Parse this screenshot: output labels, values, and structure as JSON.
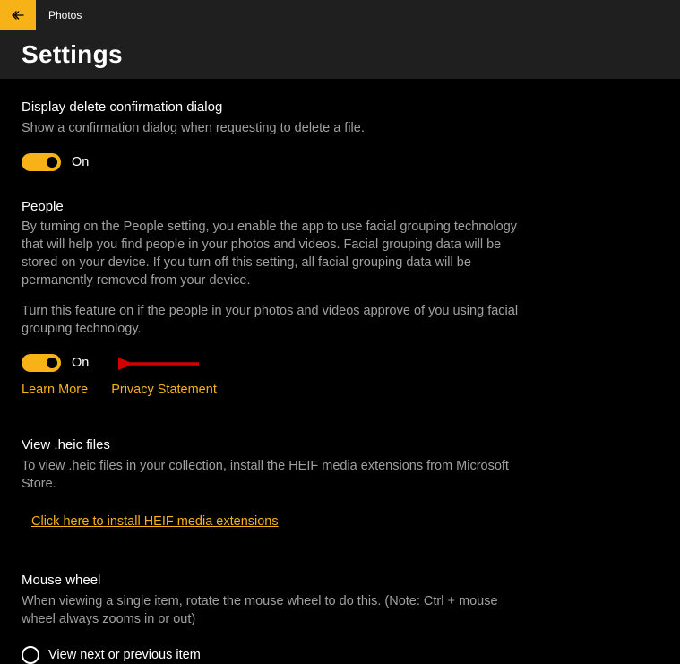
{
  "app": {
    "title": "Photos"
  },
  "header": {
    "title": "Settings"
  },
  "sections": {
    "delete": {
      "title": "Display delete confirmation dialog",
      "desc": "Show a confirmation dialog when requesting to delete a file.",
      "toggle_state": "On"
    },
    "people": {
      "title": "People",
      "desc1": "By turning on the People setting, you enable the app to use facial grouping technology that will help you find people in your photos and videos. Facial grouping data will be stored on your device. If you turn off this setting, all facial grouping data will be permanently removed from your device.",
      "desc2": "Turn this feature on if the people in your photos and videos approve of you using facial grouping technology.",
      "toggle_state": "On",
      "link_learn": "Learn More",
      "link_privacy": "Privacy Statement"
    },
    "heic": {
      "title": "View .heic files",
      "desc": "To view .heic files in your collection, install the HEIF media extensions from Microsoft Store.",
      "link": "Click here to install HEIF media extensions"
    },
    "mouse": {
      "title": "Mouse wheel",
      "desc": "When viewing a single item, rotate the mouse wheel to do this. (Note: Ctrl + mouse wheel always zooms in or out)",
      "option1": "View next or previous item"
    }
  },
  "colors": {
    "accent": "#f7b218"
  }
}
